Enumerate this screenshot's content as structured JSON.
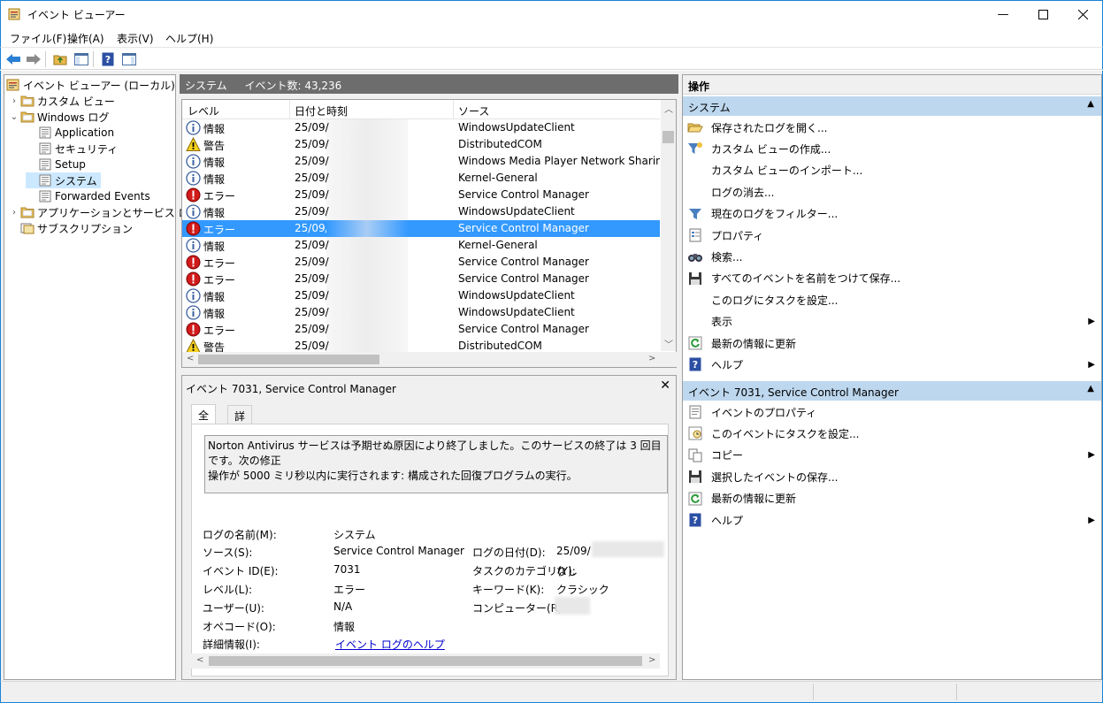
{
  "window": {
    "title": "イベント ビューアー"
  },
  "menu": [
    "ファイル(F)",
    "操作(A)",
    "表示(V)",
    "ヘルプ(H)"
  ],
  "tree": {
    "items": [
      {
        "label": "イベント ビューアー (ローカル)",
        "level": 0,
        "icon": "event-viewer-icon"
      },
      {
        "label": "カスタム ビュー",
        "level": 1,
        "icon": "folder-icon",
        "chevron": "right"
      },
      {
        "label": "Windows ログ",
        "level": 1,
        "icon": "folder-icon",
        "chevron": "down"
      },
      {
        "label": "Application",
        "level": 2,
        "icon": "log-icon"
      },
      {
        "label": "セキュリティ",
        "level": 2,
        "icon": "log-icon"
      },
      {
        "label": "Setup",
        "level": 2,
        "icon": "log-icon"
      },
      {
        "label": "システム",
        "level": 2,
        "icon": "log-icon",
        "selected": true
      },
      {
        "label": "Forwarded Events",
        "level": 2,
        "icon": "log-icon"
      },
      {
        "label": "アプリケーションとサービス ログ",
        "level": 1,
        "icon": "folder-icon",
        "chevron": "right"
      },
      {
        "label": "サブスクリプション",
        "level": 1,
        "icon": "subscription-icon"
      }
    ]
  },
  "center": {
    "header_name": "システム",
    "header_count": "イベント数: 43,236",
    "columns": [
      "レベル",
      "日付と時刻",
      "ソース"
    ],
    "rows": [
      {
        "level": "情報",
        "type": "info",
        "date": "25/09/",
        "source": "WindowsUpdateClient"
      },
      {
        "level": "警告",
        "type": "warn",
        "date": "25/09/",
        "source": "DistributedCOM"
      },
      {
        "level": "情報",
        "type": "info",
        "date": "25/09/",
        "source": "Windows Media Player Network Sharing Service"
      },
      {
        "level": "情報",
        "type": "info",
        "date": "25/09/",
        "source": "Kernel-General"
      },
      {
        "level": "エラー",
        "type": "error",
        "date": "25/09/",
        "source": "Service Control Manager"
      },
      {
        "level": "情報",
        "type": "info",
        "date": "25/09/",
        "source": "WindowsUpdateClient"
      },
      {
        "level": "エラー",
        "type": "error",
        "date": "25/09/",
        "source": "Service Control Manager",
        "selected": true
      },
      {
        "level": "情報",
        "type": "info",
        "date": "25/09/",
        "source": "Kernel-General"
      },
      {
        "level": "エラー",
        "type": "error",
        "date": "25/09/",
        "source": "Service Control Manager"
      },
      {
        "level": "エラー",
        "type": "error",
        "date": "25/09/",
        "source": "Service Control Manager"
      },
      {
        "level": "情報",
        "type": "info",
        "date": "25/09/",
        "source": "WindowsUpdateClient"
      },
      {
        "level": "情報",
        "type": "info",
        "date": "25/09/",
        "source": "WindowsUpdateClient"
      },
      {
        "level": "エラー",
        "type": "error",
        "date": "25/09/",
        "source": "Service Control Manager"
      },
      {
        "level": "警告",
        "type": "warn",
        "date": "25/09/",
        "source": "DistributedCOM"
      }
    ]
  },
  "detail": {
    "title": "イベント 7031, Service Control Manager",
    "tabs": [
      "全般",
      "詳細"
    ],
    "description_line1": "Norton Antivirus サービスは予期せぬ原因により終了しました。このサービスの終了は 3 回目です。次の修正",
    "description_line2": "操作が 5000 ミリ秒以内に実行されます: 構成された回復プログラムの実行。",
    "labels": {
      "log_name": "ログの名前(M):",
      "source": "ソース(S):",
      "event_id": "イベント ID(E):",
      "level": "レベル(L):",
      "user": "ユーザー(U):",
      "opcode": "オペコード(O):",
      "more_info": "詳細情報(I):",
      "logged": "ログの日付(D):",
      "task_category": "タスクのカテゴリ(Y):",
      "keywords": "キーワード(K):",
      "computer": "コンピューター(R):"
    },
    "values": {
      "log_name": "システム",
      "source": "Service Control Manager",
      "event_id": "7031",
      "level": "エラー",
      "user": "N/A",
      "opcode": "情報",
      "more_info": "イベント ログのヘルプ",
      "logged": "25/09/",
      "task_category": "なし",
      "keywords": "クラシック",
      "computer": ""
    }
  },
  "actions": {
    "header": "操作",
    "section1": "システム",
    "section1_items": [
      {
        "label": "保存されたログを開く...",
        "icon": "open-folder-icon"
      },
      {
        "label": "カスタム ビューの作成...",
        "icon": "filter-star-icon"
      },
      {
        "label": "カスタム ビューのインポート...",
        "icon": ""
      },
      {
        "label": "ログの消去...",
        "icon": ""
      },
      {
        "label": "現在のログをフィルター...",
        "icon": "filter-icon"
      },
      {
        "label": "プロパティ",
        "icon": "properties-icon"
      },
      {
        "label": "検索...",
        "icon": "binoculars-icon"
      },
      {
        "label": "すべてのイベントを名前をつけて保存...",
        "icon": "save-icon"
      },
      {
        "label": "このログにタスクを設定...",
        "icon": ""
      },
      {
        "label": "表示",
        "icon": "",
        "submenu": true
      },
      {
        "label": "最新の情報に更新",
        "icon": "refresh-icon"
      },
      {
        "label": "ヘルプ",
        "icon": "help-icon",
        "submenu": true
      }
    ],
    "section2": "イベント 7031, Service Control Manager",
    "section2_items": [
      {
        "label": "イベントのプロパティ",
        "icon": "event-properties-icon"
      },
      {
        "label": "このイベントにタスクを設定...",
        "icon": "task-icon"
      },
      {
        "label": "コピー",
        "icon": "copy-icon",
        "submenu": true
      },
      {
        "label": "選択したイベントの保存...",
        "icon": "save-icon"
      },
      {
        "label": "最新の情報に更新",
        "icon": "refresh-icon"
      },
      {
        "label": "ヘルプ",
        "icon": "help-icon",
        "submenu": true
      }
    ]
  },
  "colors": {
    "accent": "#1883d7",
    "selection": "#3399ff",
    "section_header": "#bdd7ee",
    "center_header": "#6d6d6d"
  }
}
